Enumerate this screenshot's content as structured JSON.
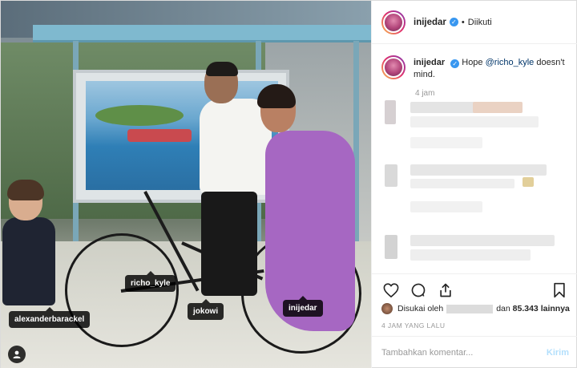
{
  "photo": {
    "tags": [
      {
        "id": "alexanderbarackel",
        "label": "alexanderbarackel"
      },
      {
        "id": "richo_kyle",
        "label": "richo_kyle"
      },
      {
        "id": "jokowi",
        "label": "jokowi"
      },
      {
        "id": "inijedar",
        "label": "inijedar"
      }
    ],
    "user_tags_icon": "user-tags-icon"
  },
  "header": {
    "username": "inijedar",
    "verified_icon": "verified-badge-icon",
    "separator": "•",
    "follow_status": "Diikuti"
  },
  "caption": {
    "username": "inijedar",
    "text_before": "Hope ",
    "mention": "@richo_kyle",
    "text_after": " doesn't mind.",
    "time": "4 jam"
  },
  "actions": {
    "like_icon": "heart-icon",
    "comment_icon": "comment-icon",
    "share_icon": "share-icon",
    "save_icon": "bookmark-icon"
  },
  "likes": {
    "prefix": "Disukai oleh",
    "middle": "dan",
    "count_text": "85.343 lainnya"
  },
  "posted_ago": "4 JAM YANG LALU",
  "comment_box": {
    "placeholder": "Tambahkan komentar...",
    "post_label": "Kirim"
  },
  "colors": {
    "link": "#003569",
    "verified": "#3897f0",
    "post_disabled": "#b2dffc",
    "muted": "#999999"
  }
}
